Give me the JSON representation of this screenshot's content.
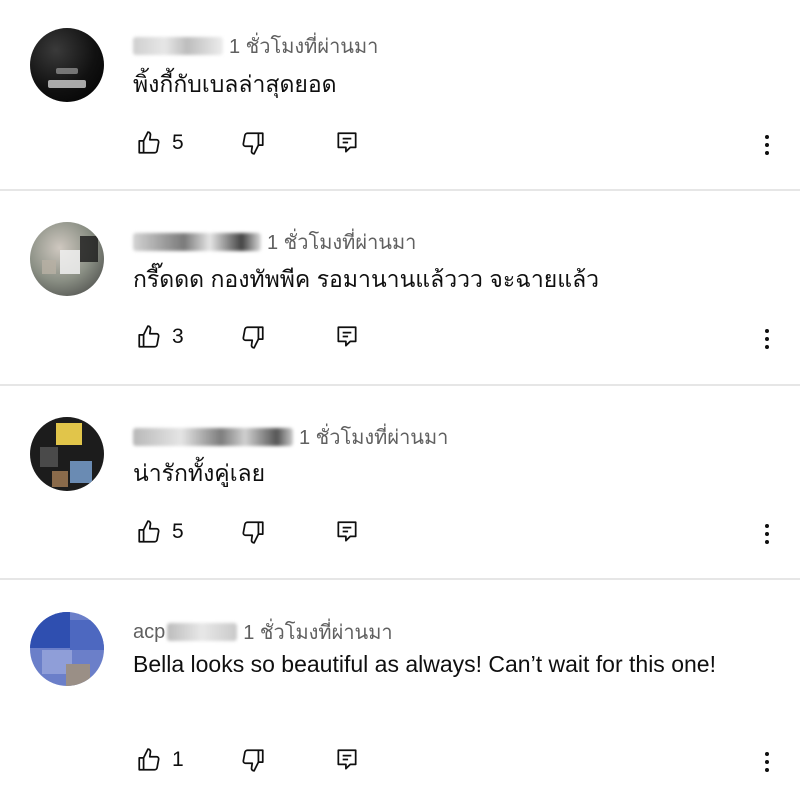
{
  "comments": [
    {
      "author": "",
      "time": "1 ชั่วโมงที่ผ่านมา",
      "text": "พิ้งกี้กับเบลล่าสุดยอด",
      "likes": "5",
      "avatar_colors": [
        "#111111",
        "#2b2b2b",
        "#d8d8d8"
      ]
    },
    {
      "author": "",
      "time": "1 ชั่วโมงที่ผ่านมา",
      "text": "กรี๊ดดด กองทัพพีค รอมานานแล้ววว จะฉายแล้ว",
      "likes": "3",
      "avatar_colors": [
        "#3a3a3a",
        "#cfc8c0",
        "#8a8f84"
      ]
    },
    {
      "author": "",
      "time": "1 ชั่วโมงที่ผ่านมา",
      "text": "น่ารักทั้งคู่เลย",
      "likes": "5",
      "avatar_colors": [
        "#1c1c1c",
        "#e1c54a",
        "#6a8bb3"
      ]
    },
    {
      "author": "acp",
      "time": "1 ชั่วโมงที่ผ่านมา",
      "text": "Bella looks so beautiful as always! Can’t wait for this one!",
      "likes": "1",
      "avatar_colors": [
        "#2f4fb0",
        "#6b7fc9",
        "#9a8f86"
      ]
    }
  ],
  "icons": {
    "like": "thumbs-up-icon",
    "dislike": "thumbs-down-icon",
    "reply": "reply-icon",
    "more": "more-vertical-icon"
  }
}
